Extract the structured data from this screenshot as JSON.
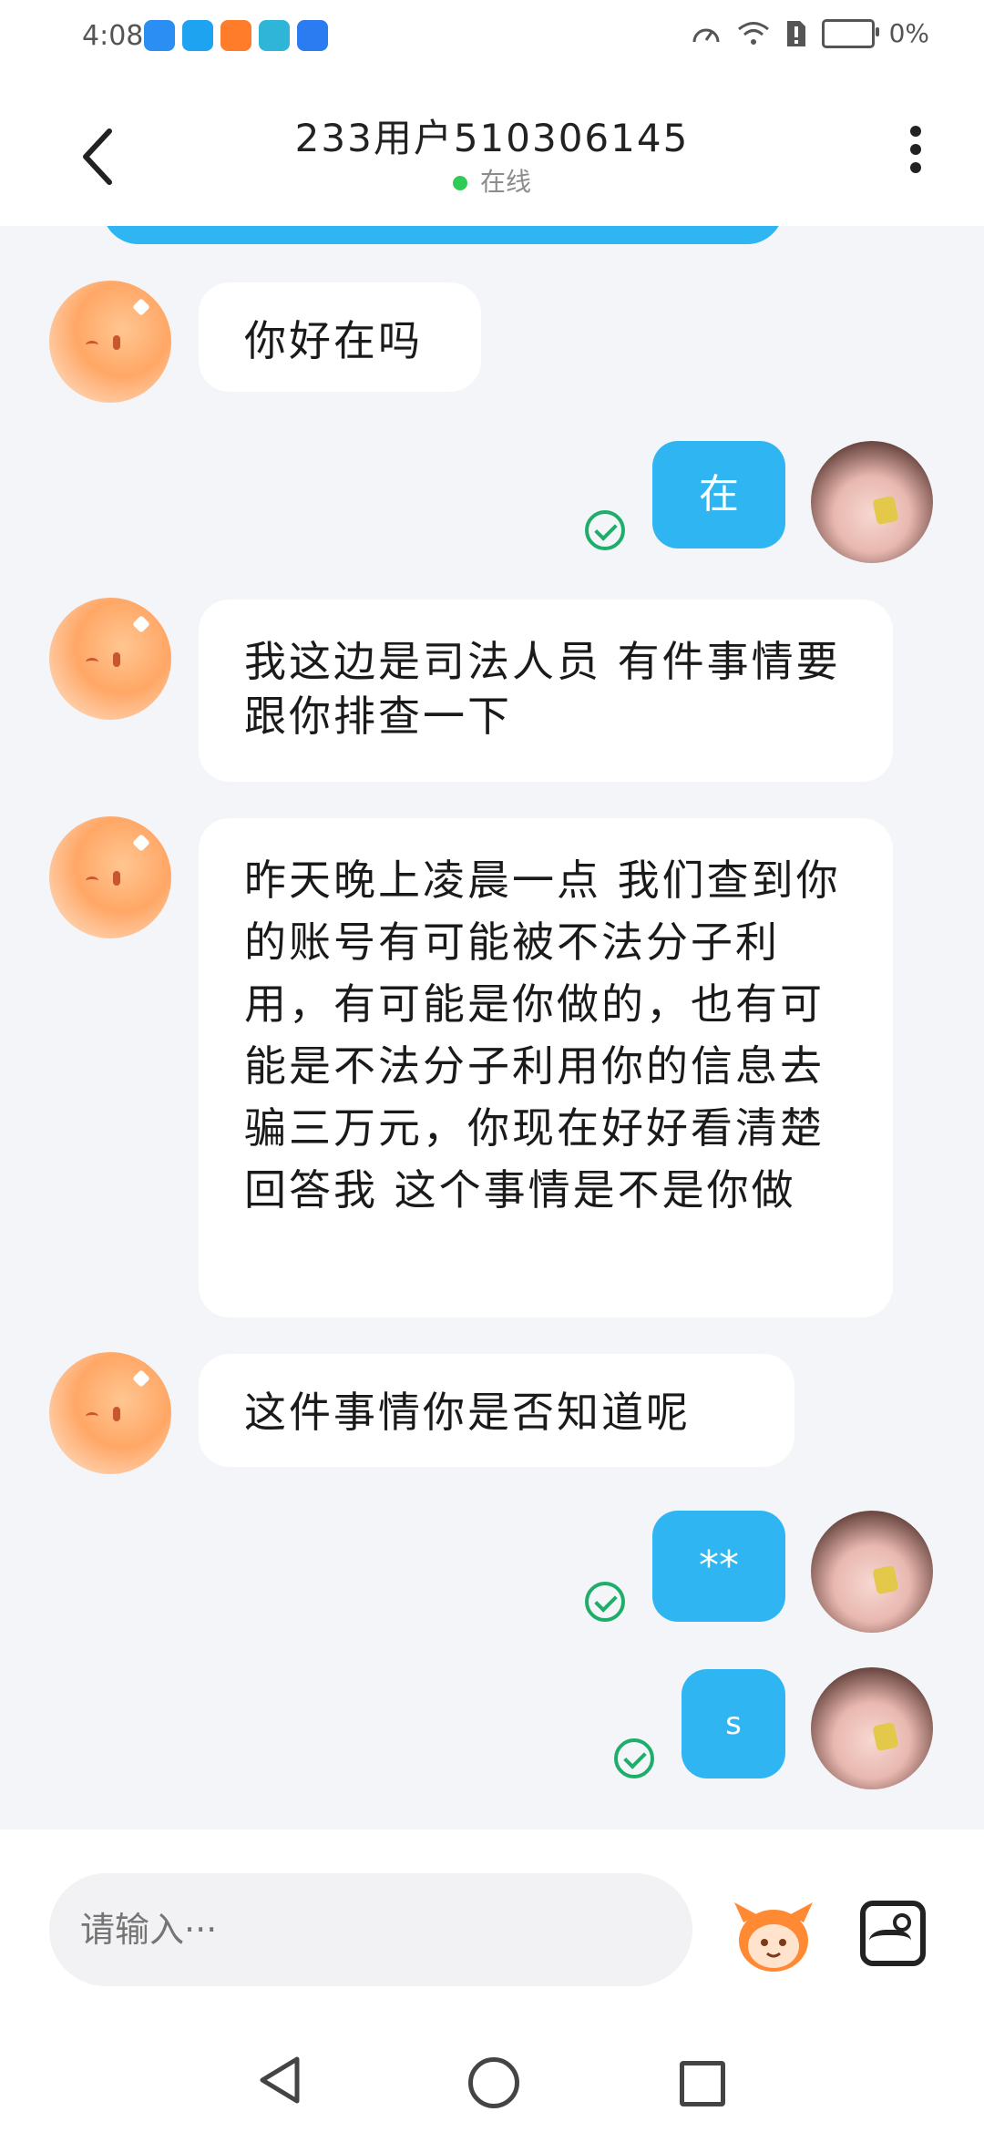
{
  "status_bar": {
    "time": "4:08",
    "battery": "0%",
    "app_icon_colors": [
      "#2a8ef2",
      "#1ea3f1",
      "#ff7d2a",
      "#2fb5d8",
      "#2b7cf0"
    ]
  },
  "header": {
    "title": "233用户510306145",
    "online_status": "在线"
  },
  "messages": [
    {
      "side": "left",
      "text": "你好在吗"
    },
    {
      "side": "right",
      "text": "在"
    },
    {
      "side": "left",
      "text": "我这边是司法人员 有件事情要跟你排查一下"
    },
    {
      "side": "left",
      "text": "昨天晚上凌晨一点 我们查到你的账号有可能被不法分子利用，有可能是你做的，也有可能是不法分子利用你的信息去骗三万元，你现在好好看清楚回答我 这个事情是不是你做"
    },
    {
      "side": "left",
      "text": "这件事情你是否知道呢"
    },
    {
      "side": "right",
      "text": "**"
    },
    {
      "side": "right",
      "text": "s"
    }
  ],
  "input": {
    "placeholder": "请输入···"
  },
  "colors": {
    "bubble_blue": "#2fb6f2",
    "background": "#f3f5f9",
    "online_green": "#2ecc55",
    "sent_check": "#1eae6a"
  }
}
